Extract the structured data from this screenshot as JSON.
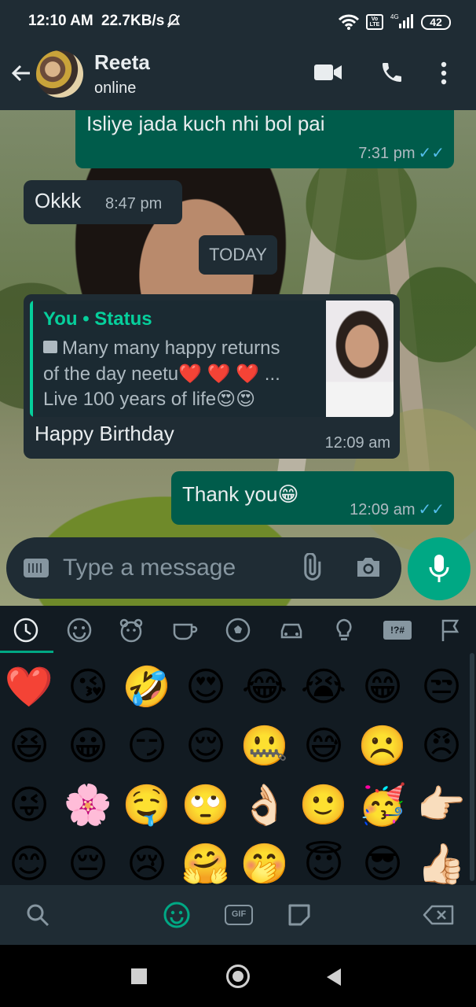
{
  "status_bar": {
    "time": "12:10 AM",
    "speed": "22.7KB/s",
    "network": "4G",
    "volte": "Vo LTE",
    "battery": "42"
  },
  "header": {
    "contact_name": "Reeta",
    "presence": "online"
  },
  "messages": [
    {
      "direction": "outgoing",
      "text": "Isliye jada kuch nhi bol pai",
      "time": "7:31 pm",
      "read": true
    },
    {
      "direction": "incoming",
      "text": "Okkk",
      "time": "8:47 pm"
    },
    {
      "direction": "incoming",
      "reply": {
        "author": "You • Status",
        "line1": "Many many happy returns",
        "line2": "of the day neetu❤️ ❤️ ❤️ ...",
        "line3": "Live 100 years of life😍😍"
      },
      "text": "Happy Birthday",
      "time": "12:09 am"
    },
    {
      "direction": "outgoing",
      "text": "Thank you😁",
      "time": "12:09 am",
      "read": true
    }
  ],
  "date_divider": "TODAY",
  "composer": {
    "placeholder": "Type a message"
  },
  "emoji_keyboard": {
    "categories": [
      "recent",
      "smileys",
      "animals",
      "food",
      "activity",
      "travel",
      "objects",
      "symbols",
      "flags"
    ],
    "symbols_label": "!?#",
    "active_category": "recent",
    "emojis": [
      "❤️",
      "😘",
      "🤣",
      "😍",
      "😂",
      "😭",
      "😁",
      "😒",
      "😆",
      "😀",
      "😏",
      "😌",
      "🤐",
      "😅",
      "☹️",
      "😠",
      "😜",
      "🌸",
      "🤤",
      "🙄",
      "👌🏻",
      "🙂",
      "🥳",
      "👉🏻",
      "😊",
      "😔",
      "😢",
      "🤗",
      "🤭",
      "😇",
      "😎",
      "👍🏻"
    ],
    "gif_label": "GIF"
  },
  "colors": {
    "header_bg": "#1f2c34",
    "outgoing_bubble": "#005c4b",
    "incoming_bubble": "#1f2c34",
    "accent": "#00a884",
    "read_ticks": "#53bdeb"
  }
}
